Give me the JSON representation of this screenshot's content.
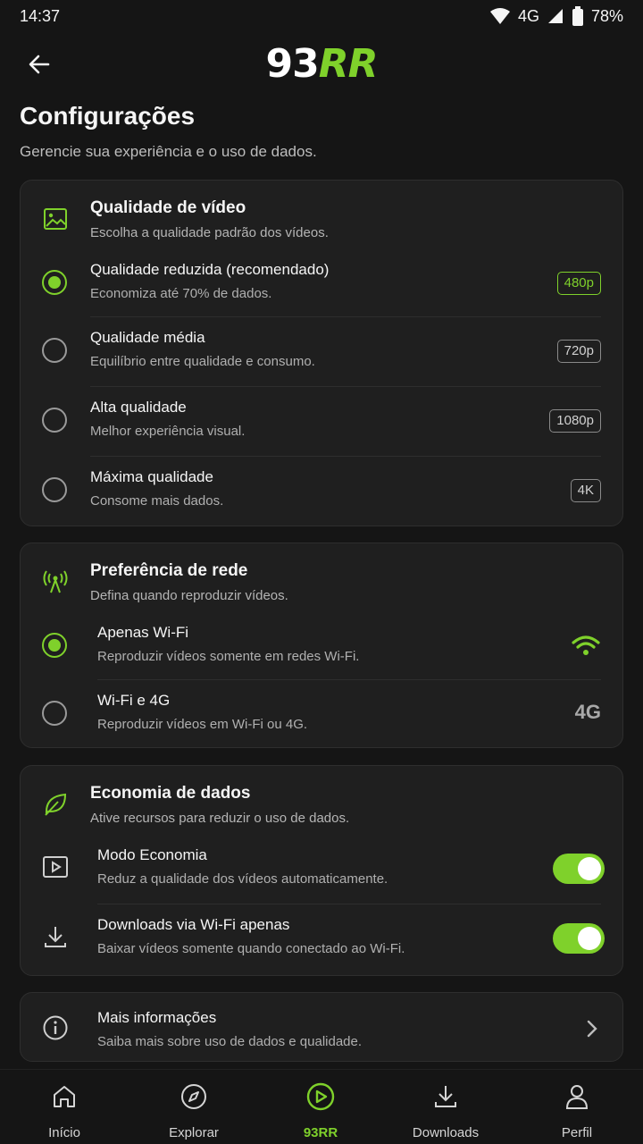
{
  "status": {
    "time": "14:37",
    "network": "4G",
    "battery": "78%"
  },
  "header": {
    "logo_num": "93",
    "logo_acc": "RR"
  },
  "page": {
    "title": "Configurações",
    "subtitle": "Gerencie sua experiência e o uso de dados."
  },
  "video_quality": {
    "title": "Qualidade de vídeo",
    "desc": "Escolha a qualidade padrão dos vídeos.",
    "options": [
      {
        "title": "Qualidade reduzida (recomendado)",
        "sub": "Economiza até 70% de dados.",
        "badge": "480p",
        "selected": true
      },
      {
        "title": "Qualidade média",
        "sub": "Equilíbrio entre qualidade e consumo.",
        "badge": "720p",
        "selected": false
      },
      {
        "title": "Alta qualidade",
        "sub": "Melhor experiência visual.",
        "badge": "1080p",
        "selected": false
      },
      {
        "title": "Máxima qualidade",
        "sub": "Consome mais dados.",
        "badge": "4K",
        "selected": false
      }
    ]
  },
  "network_pref": {
    "title": "Preferência de rede",
    "desc": "Defina quando reproduzir vídeos.",
    "options": [
      {
        "title": "Apenas Wi-Fi",
        "sub": "Reproduzir vídeos somente em redes Wi-Fi.",
        "indicator": "wifi-icon",
        "selected": true
      },
      {
        "title": "Wi-Fi e 4G",
        "sub": "Reproduzir vídeos em Wi-Fi ou 4G.",
        "indicator": "4G",
        "selected": false
      }
    ]
  },
  "data_saver": {
    "title": "Economia de dados",
    "desc": "Ative recursos para reduzir o uso de dados.",
    "items": [
      {
        "title": "Modo Economia",
        "sub": "Reduz a qualidade dos vídeos automaticamente.",
        "icon": "play-box-icon",
        "enabled": true
      },
      {
        "title": "Downloads via Wi-Fi apenas",
        "sub": "Baixar vídeos somente quando conectado ao Wi-Fi.",
        "icon": "download-icon",
        "enabled": true
      }
    ]
  },
  "more_info": {
    "title": "Mais informações",
    "sub": "Saiba mais sobre uso de dados e qualidade."
  },
  "nav": [
    {
      "label": "Início",
      "icon": "home-icon",
      "active": false
    },
    {
      "label": "Explorar",
      "icon": "compass-icon",
      "active": false
    },
    {
      "label": "93RR",
      "icon": "play-circle-icon",
      "active": true
    },
    {
      "label": "Downloads",
      "icon": "download-icon",
      "active": false
    },
    {
      "label": "Perfil",
      "icon": "user-icon",
      "active": false
    }
  ],
  "colors": {
    "accent": "#7fd12b",
    "background": "#151515",
    "card": "#1f1f1f"
  }
}
